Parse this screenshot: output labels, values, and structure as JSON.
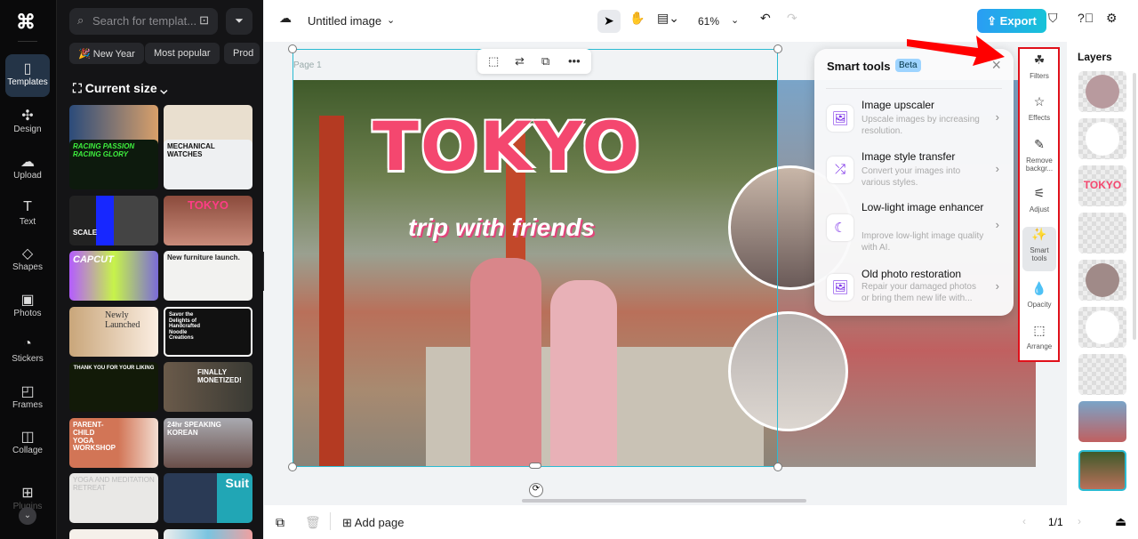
{
  "rail": {
    "items": [
      {
        "label": "Templates"
      },
      {
        "label": "Design"
      },
      {
        "label": "Upload"
      },
      {
        "label": "Text"
      },
      {
        "label": "Shapes"
      },
      {
        "label": "Photos"
      },
      {
        "label": "Stickers"
      },
      {
        "label": "Frames"
      },
      {
        "label": "Collage"
      },
      {
        "label": "Plugins"
      }
    ]
  },
  "panel": {
    "search_placeholder": "Search for templat...",
    "chips": [
      "🎉 New Year",
      "Most popular",
      "Prod"
    ],
    "current_size": "Current size",
    "thumbs": [
      "RACING PASSION RACING GLORY",
      "MECHANICAL WATCHES",
      "SCALE",
      "TOKYO",
      "CAPCUT",
      "New furniture launch.",
      "Newly Launched",
      "Savor the Delights of Handcrafted Noodle Creations",
      "THANK YOU FOR YOUR LIKING",
      "FINALLY MONETIZED!",
      "PARENT-CHILD YOGA WORKSHOP",
      "24hr SPEAKING KOREAN",
      "YOGA AND MEDITATION RETREAT",
      "Suit"
    ]
  },
  "topbar": {
    "title": "Untitled image",
    "zoom": "61%",
    "export": "Export"
  },
  "canvas": {
    "page_label": "Page 1",
    "headline": "TOKYO",
    "subhead": "trip with friends"
  },
  "smart_tools": {
    "title": "Smart tools",
    "badge": "Beta",
    "items": [
      {
        "title": "Image upscaler",
        "desc": "Upscale images by increasing resolution."
      },
      {
        "title": "Image style transfer",
        "desc": "Convert your images into various styles."
      },
      {
        "title": "Low-light image enhancer",
        "desc": "Improve low-light image quality with AI."
      },
      {
        "title": "Old photo restoration",
        "desc": "Repair your damaged photos or bring them new life with..."
      }
    ]
  },
  "right_tools": [
    {
      "label": "Filters"
    },
    {
      "label": "Effects"
    },
    {
      "label": "Remove backgr..."
    },
    {
      "label": "Adjust"
    },
    {
      "label": "Smart tools"
    },
    {
      "label": "Opacity"
    },
    {
      "label": "Arrange"
    }
  ],
  "layers": {
    "title": "Layers",
    "text_layer": "TOKYO"
  },
  "bottom": {
    "add_page": "Add page",
    "page_count": "1/1"
  }
}
